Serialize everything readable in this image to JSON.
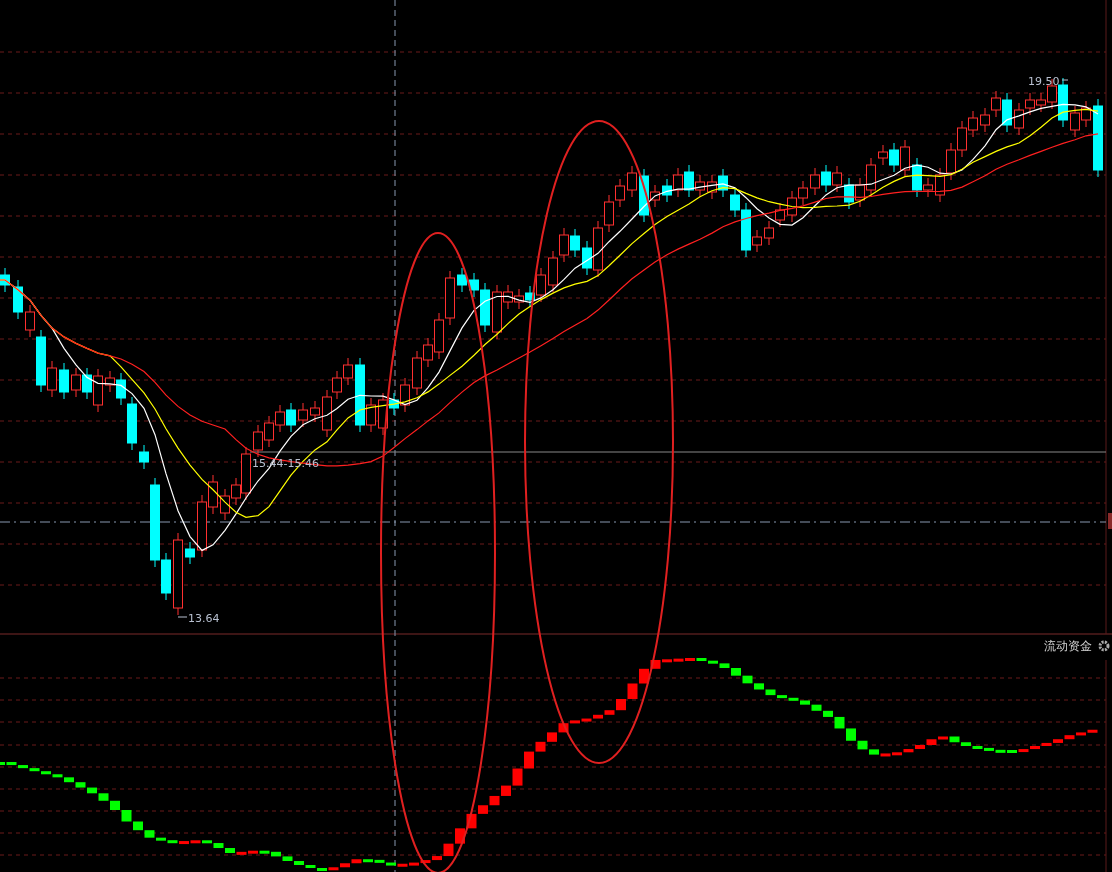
{
  "price_chart": {
    "high_label": "19.50",
    "low_label": "13.64",
    "crosshair_label": "15.44-15.46"
  },
  "indicator_panel": {
    "title": "流动资金"
  }
}
